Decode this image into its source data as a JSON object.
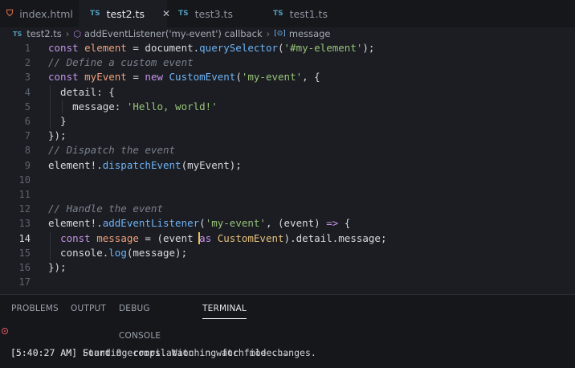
{
  "tabs": [
    {
      "label": "index.html",
      "icon": "html5-icon",
      "glyph": "⛉",
      "active": false
    },
    {
      "label": "test2.ts",
      "icon": "typescript-icon",
      "glyph": "TS",
      "active": true,
      "close": "✕"
    },
    {
      "label": "test3.ts",
      "icon": "typescript-icon",
      "glyph": "TS",
      "active": false
    },
    {
      "label": "test1.ts",
      "icon": "typescript-icon",
      "glyph": "TS",
      "active": false
    }
  ],
  "breadcrumb": {
    "file": "test2.ts",
    "file_glyph": "TS",
    "callback": "addEventListener('my-event') callback",
    "callback_glyph": "⬡",
    "variable": "message",
    "variable_glyph": "[⊙]",
    "separator": "›"
  },
  "editor": {
    "current_line": 14,
    "lines": [
      {
        "n": "1",
        "t": [
          [
            "kw",
            "const "
          ],
          [
            "vr",
            "element"
          ],
          [
            "pr",
            " = "
          ],
          [
            "pr",
            "document."
          ],
          [
            "fn",
            "querySelector"
          ],
          [
            "pr",
            "("
          ],
          [
            "st",
            "'#my-element'"
          ],
          [
            "pr",
            ");"
          ]
        ]
      },
      {
        "n": "2",
        "t": [
          [
            "cm",
            "// Define a custom event"
          ]
        ]
      },
      {
        "n": "3",
        "t": [
          [
            "kw",
            "const "
          ],
          [
            "vr",
            "myEvent"
          ],
          [
            "pr",
            " = "
          ],
          [
            "kw",
            "new "
          ],
          [
            "fn",
            "CustomEvent"
          ],
          [
            "pr",
            "("
          ],
          [
            "st",
            "'my-event'"
          ],
          [
            "pr",
            ", {"
          ]
        ]
      },
      {
        "n": "4",
        "t": [
          [
            "pr",
            "  detail: {"
          ]
        ]
      },
      {
        "n": "5",
        "t": [
          [
            "pr",
            "    message: "
          ],
          [
            "st",
            "'Hello, world!'"
          ]
        ]
      },
      {
        "n": "6",
        "t": [
          [
            "pr",
            "  }"
          ]
        ]
      },
      {
        "n": "7",
        "t": [
          [
            "pr",
            "});"
          ]
        ]
      },
      {
        "n": "8",
        "t": [
          [
            "cm",
            "// Dispatch the event"
          ]
        ]
      },
      {
        "n": "9",
        "t": [
          [
            "pr",
            "element!."
          ],
          [
            "fn",
            "dispatchEvent"
          ],
          [
            "pr",
            "(myEvent);"
          ]
        ]
      },
      {
        "n": "10",
        "t": []
      },
      {
        "n": "11",
        "t": []
      },
      {
        "n": "12",
        "t": [
          [
            "cm",
            "// Handle the event"
          ]
        ]
      },
      {
        "n": "13",
        "t": [
          [
            "pr",
            "element!."
          ],
          [
            "fn",
            "addEventListener"
          ],
          [
            "pr",
            "("
          ],
          [
            "st",
            "'my-event'"
          ],
          [
            "pr",
            ", (event) "
          ],
          [
            "kw",
            "=>"
          ],
          [
            "pr",
            " {"
          ]
        ]
      },
      {
        "n": "14",
        "t": [
          [
            "pr",
            "  "
          ],
          [
            "kw",
            "const "
          ],
          [
            "vr",
            "message"
          ],
          [
            "pr",
            " = "
          ],
          [
            "pr",
            "(event "
          ],
          [
            "kw",
            "as "
          ],
          [
            "ty",
            "CustomEvent"
          ],
          [
            "pr",
            ")"
          ],
          [
            "pr",
            ".detail.message;"
          ]
        ]
      },
      {
        "n": "15",
        "t": [
          [
            "pr",
            "  console."
          ],
          [
            "fn",
            "log"
          ],
          [
            "pr",
            "(message);"
          ]
        ]
      },
      {
        "n": "16",
        "t": [
          [
            "pr",
            "});"
          ]
        ]
      },
      {
        "n": "17",
        "t": []
      }
    ]
  },
  "panel": {
    "tabs": [
      "PROBLEMS",
      "OUTPUT",
      "DEBUG CONSOLE",
      "TERMINAL"
    ],
    "active_tab": "TERMINAL",
    "terminal_lines": [
      "[5:40:27 AM] Starting compilation in watch mode...",
      "[5:40:27 AM] Found 0 errors. Watching for file changes."
    ]
  },
  "colors": {
    "background": "#1b1d22",
    "keyword": "#c594e8",
    "string": "#98c379",
    "function": "#6fb3f5",
    "variable": "#f0a07b",
    "type": "#e5c07b",
    "comment": "#7a808c",
    "cursor": "#e8c15c",
    "error_dot": "#e05561"
  }
}
